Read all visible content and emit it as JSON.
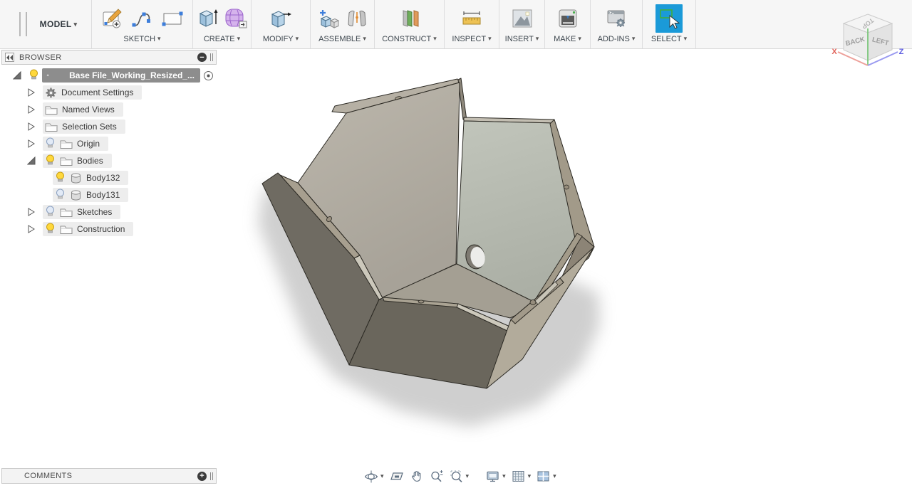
{
  "toolbar": {
    "workspace": {
      "label": "MODEL"
    },
    "groups": [
      {
        "label": "SKETCH",
        "tools": [
          "create-sketch",
          "spline",
          "two-point-rectangle"
        ]
      },
      {
        "label": "CREATE",
        "tools": [
          "extrude",
          "create-form"
        ]
      },
      {
        "label": "MODIFY",
        "tools": [
          "press-pull"
        ]
      },
      {
        "label": "ASSEMBLE",
        "tools": [
          "new-component",
          "joint"
        ]
      },
      {
        "label": "CONSTRUCT",
        "tools": [
          "construction-plane"
        ]
      },
      {
        "label": "INSPECT",
        "tools": [
          "measure"
        ]
      },
      {
        "label": "INSERT",
        "tools": [
          "attached-canvas"
        ]
      },
      {
        "label": "MAKE",
        "tools": [
          "3d-print"
        ]
      },
      {
        "label": "ADD-INS",
        "tools": [
          "scripts-and-add-ins"
        ]
      },
      {
        "label": "SELECT",
        "tools": [
          "select"
        ]
      }
    ],
    "colors": {
      "select_active_bg": "#1b9ad8"
    }
  },
  "browser": {
    "title": "BROWSER",
    "items": [
      {
        "label": "Base File_Working_Resized_...",
        "icon": "component",
        "bulb": "on",
        "state": "expanded",
        "selected": true
      },
      {
        "label": "Document Settings",
        "icon": "gear",
        "state": "collapsed"
      },
      {
        "label": "Named Views",
        "icon": "folder",
        "state": "collapsed"
      },
      {
        "label": "Selection Sets",
        "icon": "folder",
        "state": "collapsed"
      },
      {
        "label": "Origin",
        "icon": "folder",
        "bulb": "off",
        "state": "collapsed"
      },
      {
        "label": "Bodies",
        "icon": "folder",
        "bulb": "on",
        "state": "expanded"
      },
      {
        "label": "Body132",
        "icon": "body",
        "bulb": "on",
        "indent": 2
      },
      {
        "label": "Body131",
        "icon": "body",
        "bulb": "off",
        "indent": 2
      },
      {
        "label": "Sketches",
        "icon": "folder",
        "bulb": "off",
        "state": "collapsed"
      },
      {
        "label": "Construction",
        "icon": "folder",
        "bulb": "on",
        "state": "collapsed"
      }
    ]
  },
  "comments": {
    "title": "COMMENTS"
  },
  "viewcube": {
    "top": "TOP",
    "back": "BACK",
    "left": "LEFT",
    "axis_x": "X",
    "axis_z": "Z",
    "axis_colors": {
      "x": "#e06a60",
      "y": "#6cc06c",
      "z": "#6a6ae8"
    }
  },
  "nav_toolbar": {
    "tools": [
      {
        "name": "orbit",
        "has_menu": true
      },
      {
        "name": "look-at",
        "has_menu": false
      },
      {
        "name": "pan",
        "has_menu": false
      },
      {
        "name": "zoom",
        "has_menu": false
      },
      {
        "name": "zoom-window-fit",
        "has_menu": true
      },
      {
        "name": "display-settings",
        "has_menu": true
      },
      {
        "name": "grid-and-snaps",
        "has_menu": true
      },
      {
        "name": "viewports",
        "has_menu": true
      }
    ]
  },
  "viewport": {
    "background": "#ffffff",
    "shadow_color": "#c9c9c9",
    "model_colors": {
      "inner_left": "#b2ada2",
      "inner_right": "#b6bab0",
      "floor": "#a49f93",
      "outer_dark": "#6d695f",
      "rim_tan": "#a59d8c",
      "chamfer_light": "#ccc8bb"
    }
  }
}
